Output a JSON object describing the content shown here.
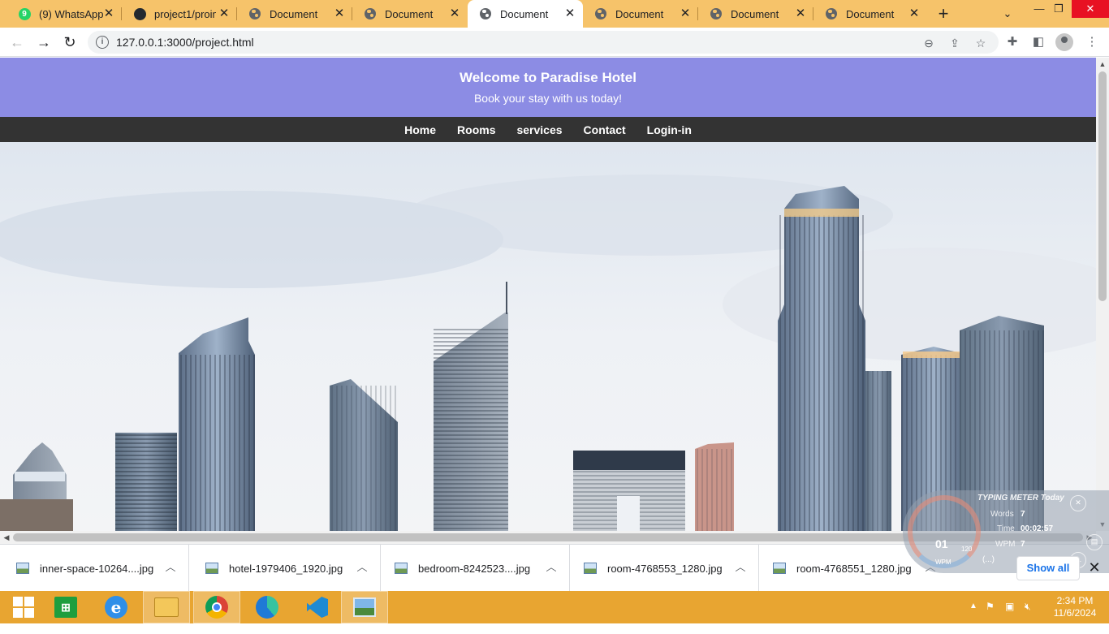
{
  "browser": {
    "tabs": [
      {
        "title": "(9) WhatsApp",
        "icon": "whatsapp-icon",
        "badge": "9"
      },
      {
        "title": "project1/proim",
        "icon": "github-icon"
      },
      {
        "title": "Document",
        "icon": "globe-icon"
      },
      {
        "title": "Document",
        "icon": "globe-icon"
      },
      {
        "title": "Document",
        "icon": "globe-icon",
        "active": true
      },
      {
        "title": "Document",
        "icon": "globe-icon"
      },
      {
        "title": "Document",
        "icon": "globe-icon"
      },
      {
        "title": "Document",
        "icon": "globe-icon"
      }
    ],
    "url": "127.0.0.1:3000/project.html",
    "tab_strip_color": "#f6c36a"
  },
  "page": {
    "header": {
      "title": "Welcome to Paradise Hotel",
      "subtitle": "Book your stay with us today!",
      "background": "#8c8ce4"
    },
    "nav": [
      "Home",
      "Rooms",
      "services",
      "Contact",
      "Login-in"
    ]
  },
  "downloads": {
    "items": [
      "inner-space-10264....jpg",
      "hotel-1979406_1920.jpg",
      "bedroom-8242523....jpg",
      "room-4768553_1280.jpg",
      "room-4768551_1280.jpg"
    ],
    "show_all": "Show all"
  },
  "typing_meter": {
    "title": "TYPING METER Today",
    "gauge_value": "01",
    "gauge_max": "120",
    "gauge_unit": "WPM",
    "words_label": "Words",
    "words_value": "7",
    "time_label": "Time",
    "time_value": "00:02:57",
    "wpm_label": "WPM",
    "wpm_value": "7",
    "search_text": "(...)"
  },
  "taskbar": {
    "time": "2:34 PM",
    "date": "11/6/2024"
  }
}
